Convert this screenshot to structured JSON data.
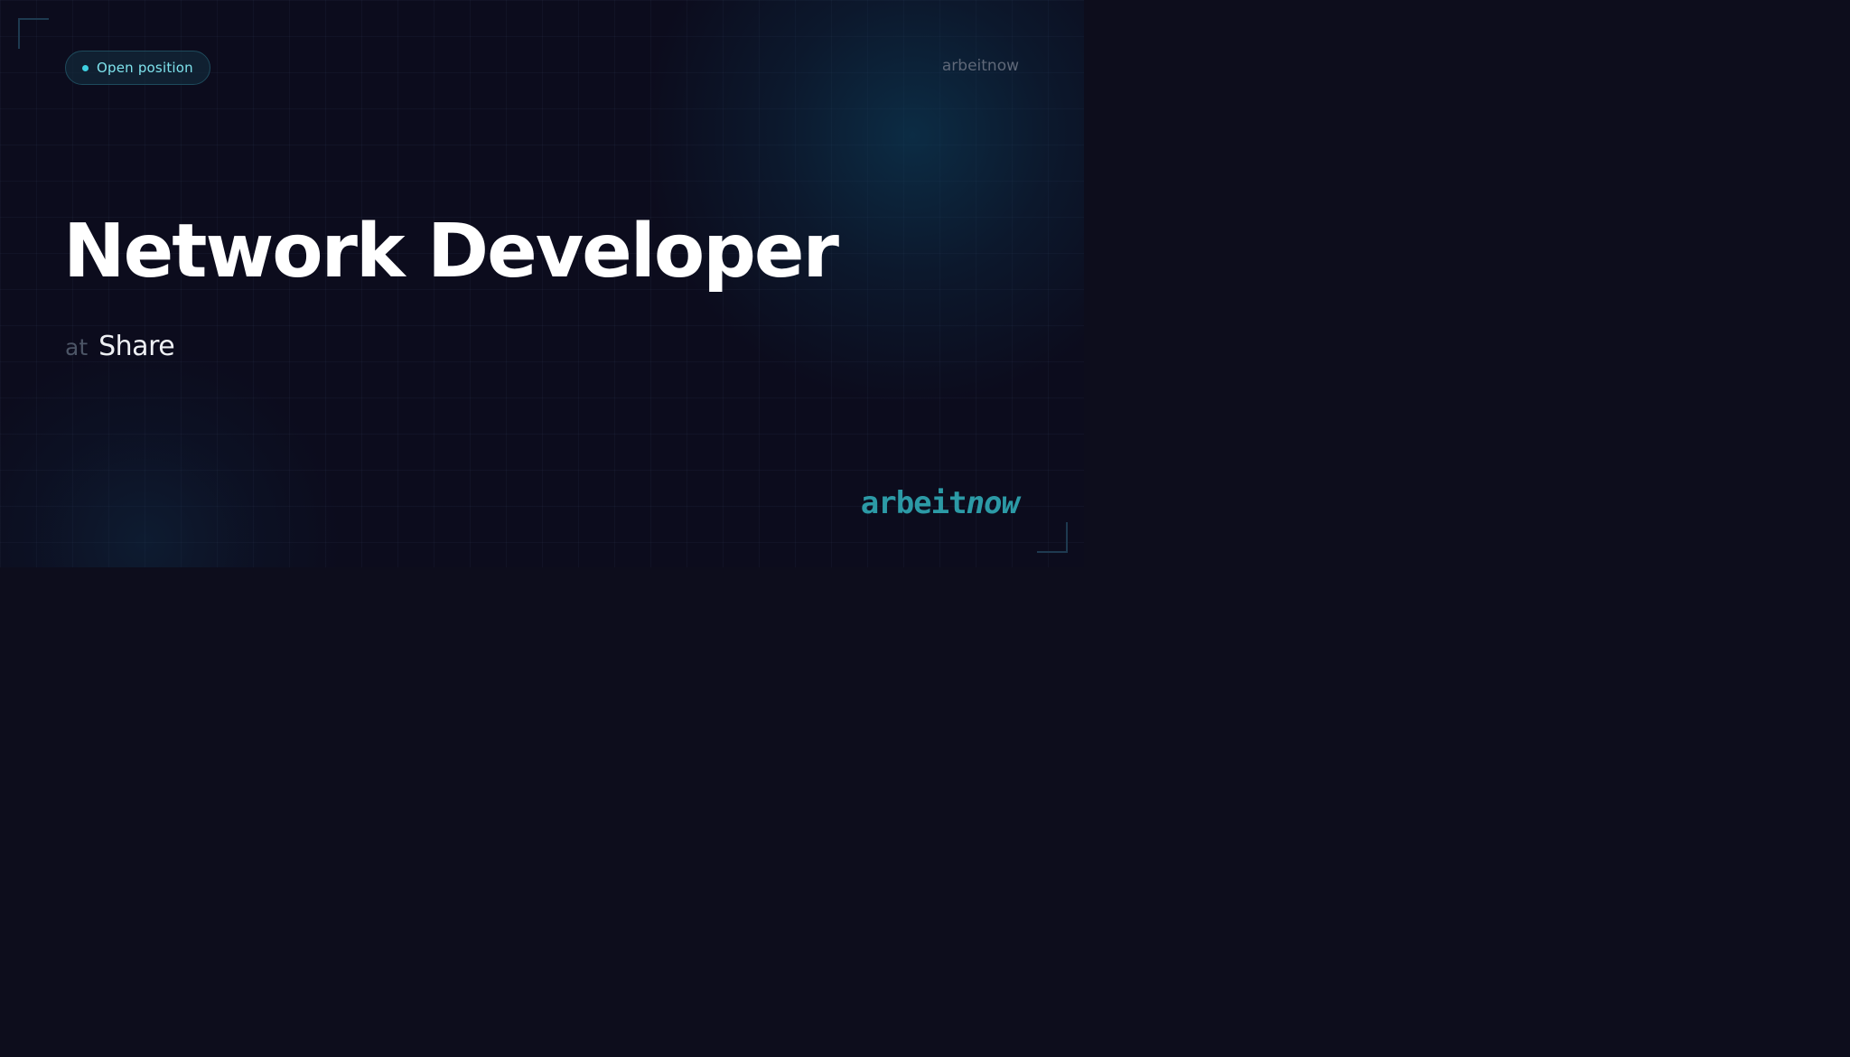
{
  "badge": {
    "label": "Open position",
    "dot_color": "#3ecfe0"
  },
  "header": {
    "brand": "arbeitnow"
  },
  "job": {
    "title": "Network Developer",
    "company_prefix": "at",
    "company": "Share"
  },
  "logo": {
    "part1": "arbeit",
    "part2": "now",
    "color": "#2c9aa6"
  },
  "colors": {
    "background": "#0c0c1d",
    "accent": "#3ecfe0",
    "title": "#ffffff"
  }
}
